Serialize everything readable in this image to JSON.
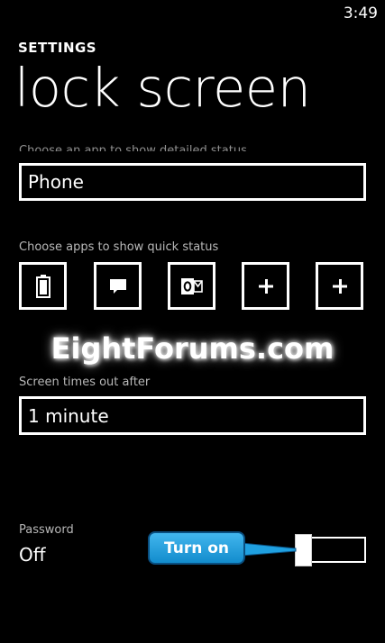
{
  "status_bar": {
    "time": "3:49"
  },
  "header": {
    "section": "SETTINGS",
    "title": "lock screen"
  },
  "detailed_status": {
    "caption": "Choose an app to show detailed status",
    "value": "Phone"
  },
  "quick_status": {
    "caption": "Choose apps to show quick status",
    "slots": [
      {
        "icon": "battery-icon"
      },
      {
        "icon": "messaging-icon"
      },
      {
        "icon": "outlook-icon"
      },
      {
        "icon": "plus-icon"
      },
      {
        "icon": "plus-icon"
      }
    ]
  },
  "watermark": "EightForums.com",
  "timeout": {
    "caption": "Screen times out after",
    "value": "1 minute"
  },
  "password": {
    "caption": "Password",
    "value": "Off",
    "toggle_on": false
  },
  "annotation": {
    "label": "Turn on",
    "color": "#1fa0e0"
  }
}
